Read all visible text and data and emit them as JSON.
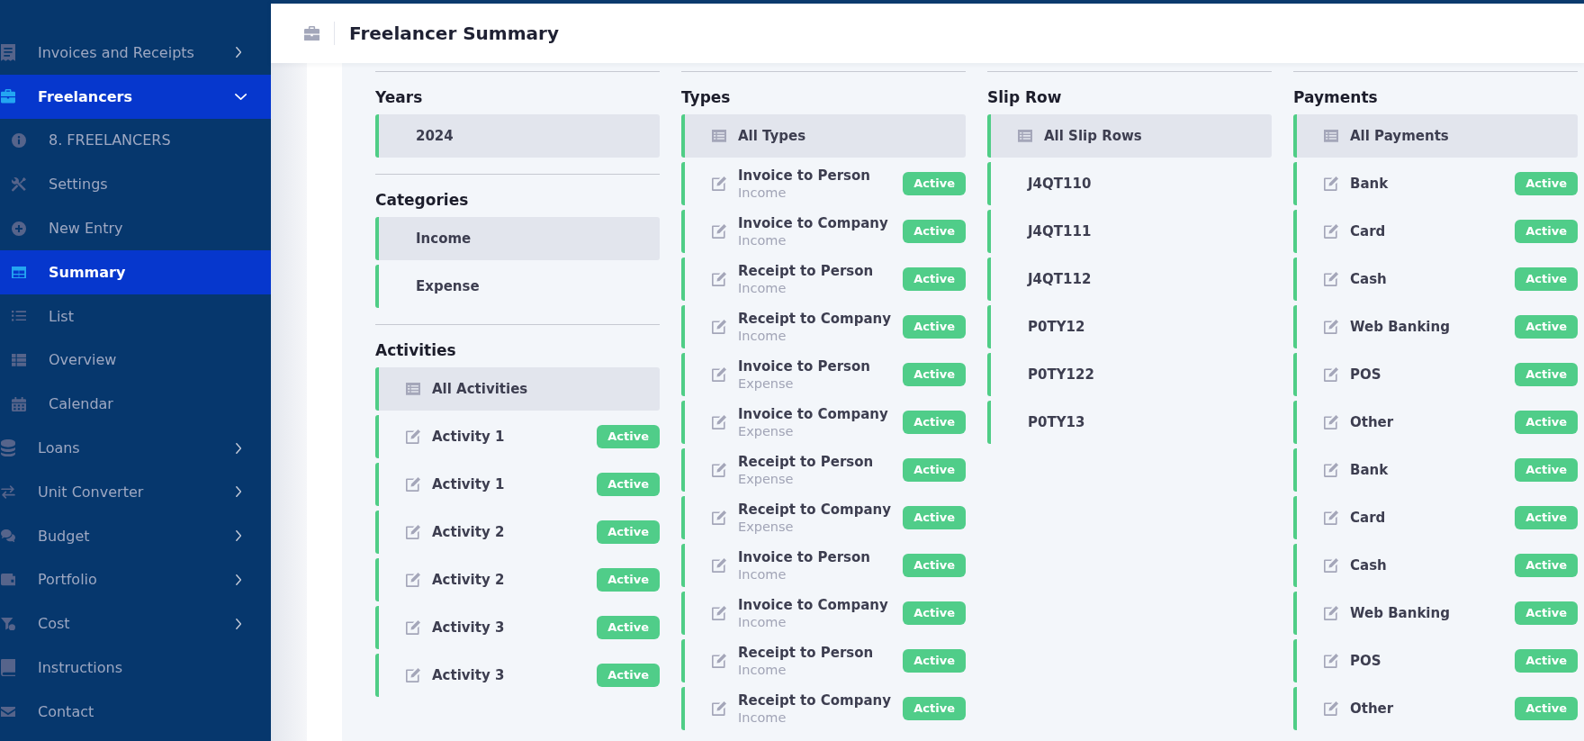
{
  "sidebar": {
    "items": [
      {
        "kind": "group",
        "label": "Invoices and Receipts",
        "selected": false,
        "expanded": false
      },
      {
        "kind": "group",
        "label": "Freelancers",
        "selected": true,
        "expanded": true,
        "children": [
          {
            "label": "8. FREELANCERS",
            "selected": false
          },
          {
            "label": "Settings",
            "selected": false
          },
          {
            "label": "New Entry",
            "selected": false
          },
          {
            "label": "Summary",
            "selected": true
          },
          {
            "label": "List",
            "selected": false
          },
          {
            "label": "Overview",
            "selected": false
          },
          {
            "label": "Calendar",
            "selected": false
          }
        ]
      },
      {
        "kind": "group",
        "label": "Loans",
        "selected": false,
        "expanded": false
      },
      {
        "kind": "group",
        "label": "Unit Converter",
        "selected": false,
        "expanded": false
      },
      {
        "kind": "group",
        "label": "Budget",
        "selected": false,
        "expanded": false
      },
      {
        "kind": "group",
        "label": "Portfolio",
        "selected": false,
        "expanded": false
      },
      {
        "kind": "group",
        "label": "Cost",
        "selected": false,
        "expanded": false
      },
      {
        "kind": "link",
        "label": "Instructions",
        "selected": false
      },
      {
        "kind": "link",
        "label": "Contact",
        "selected": false
      }
    ]
  },
  "header": {
    "title": "Freelancer Summary"
  },
  "columns": [
    {
      "sections": [
        {
          "title": "Years",
          "items": [
            {
              "kind": "plain",
              "label": "2024",
              "selected": true
            }
          ]
        },
        {
          "title": "Categories",
          "items": [
            {
              "kind": "plain",
              "label": "Income",
              "selected": true
            },
            {
              "kind": "plain",
              "label": "Expense",
              "selected": false
            }
          ]
        },
        {
          "title": "Activities",
          "items": [
            {
              "kind": "all",
              "label": "All Activities",
              "selected": true
            },
            {
              "kind": "entry",
              "label": "Activity 1",
              "badge": "Active",
              "selected": false
            },
            {
              "kind": "entry",
              "label": "Activity 1",
              "badge": "Active",
              "selected": false
            },
            {
              "kind": "entry",
              "label": "Activity 2",
              "badge": "Active",
              "selected": false
            },
            {
              "kind": "entry",
              "label": "Activity 2",
              "badge": "Active",
              "selected": false
            },
            {
              "kind": "entry",
              "label": "Activity 3",
              "badge": "Active",
              "selected": false
            },
            {
              "kind": "entry",
              "label": "Activity 3",
              "badge": "Active",
              "selected": false
            }
          ]
        }
      ]
    },
    {
      "sections": [
        {
          "title": "Types",
          "items": [
            {
              "kind": "all",
              "label": "All Types",
              "selected": true
            },
            {
              "kind": "entry",
              "label": "Invoice to Person",
              "sublabel": "Income",
              "badge": "Active",
              "selected": false
            },
            {
              "kind": "entry",
              "label": "Invoice to Company",
              "sublabel": "Income",
              "badge": "Active",
              "selected": false
            },
            {
              "kind": "entry",
              "label": "Receipt to Person",
              "sublabel": "Income",
              "badge": "Active",
              "selected": false
            },
            {
              "kind": "entry",
              "label": "Receipt to Company",
              "sublabel": "Income",
              "badge": "Active",
              "selected": false
            },
            {
              "kind": "entry",
              "label": "Invoice to Person",
              "sublabel": "Expense",
              "badge": "Active",
              "selected": false
            },
            {
              "kind": "entry",
              "label": "Invoice to Company",
              "sublabel": "Expense",
              "badge": "Active",
              "selected": false
            },
            {
              "kind": "entry",
              "label": "Receipt to Person",
              "sublabel": "Expense",
              "badge": "Active",
              "selected": false
            },
            {
              "kind": "entry",
              "label": "Receipt to Company",
              "sublabel": "Expense",
              "badge": "Active",
              "selected": false
            },
            {
              "kind": "entry",
              "label": "Invoice to Person",
              "sublabel": "Income",
              "badge": "Active",
              "selected": false
            },
            {
              "kind": "entry",
              "label": "Invoice to Company",
              "sublabel": "Income",
              "badge": "Active",
              "selected": false
            },
            {
              "kind": "entry",
              "label": "Receipt to Person",
              "sublabel": "Income",
              "badge": "Active",
              "selected": false
            },
            {
              "kind": "entry",
              "label": "Receipt to Company",
              "sublabel": "Income",
              "badge": "Active",
              "selected": false
            }
          ]
        }
      ]
    },
    {
      "sections": [
        {
          "title": "Slip Row",
          "items": [
            {
              "kind": "all",
              "label": "All Slip Rows",
              "selected": true
            },
            {
              "kind": "plain",
              "label": "J4QT110",
              "selected": false
            },
            {
              "kind": "plain",
              "label": "J4QT111",
              "selected": false
            },
            {
              "kind": "plain",
              "label": "J4QT112",
              "selected": false
            },
            {
              "kind": "plain",
              "label": "P0TY12",
              "selected": false
            },
            {
              "kind": "plain",
              "label": "P0TY122",
              "selected": false
            },
            {
              "kind": "plain",
              "label": "P0TY13",
              "selected": false
            }
          ]
        }
      ]
    },
    {
      "sections": [
        {
          "title": "Payments",
          "items": [
            {
              "kind": "all",
              "label": "All Payments",
              "selected": true
            },
            {
              "kind": "entry",
              "label": "Bank",
              "badge": "Active",
              "selected": false
            },
            {
              "kind": "entry",
              "label": "Card",
              "badge": "Active",
              "selected": false
            },
            {
              "kind": "entry",
              "label": "Cash",
              "badge": "Active",
              "selected": false
            },
            {
              "kind": "entry",
              "label": "Web Banking",
              "badge": "Active",
              "selected": false
            },
            {
              "kind": "entry",
              "label": "POS",
              "badge": "Active",
              "selected": false
            },
            {
              "kind": "entry",
              "label": "Other",
              "badge": "Active",
              "selected": false
            },
            {
              "kind": "entry",
              "label": "Bank",
              "badge": "Active",
              "selected": false
            },
            {
              "kind": "entry",
              "label": "Card",
              "badge": "Active",
              "selected": false
            },
            {
              "kind": "entry",
              "label": "Cash",
              "badge": "Active",
              "selected": false
            },
            {
              "kind": "entry",
              "label": "Web Banking",
              "badge": "Active",
              "selected": false
            },
            {
              "kind": "entry",
              "label": "POS",
              "badge": "Active",
              "selected": false
            },
            {
              "kind": "entry",
              "label": "Other",
              "badge": "Active",
              "selected": false
            }
          ]
        }
      ]
    }
  ]
}
